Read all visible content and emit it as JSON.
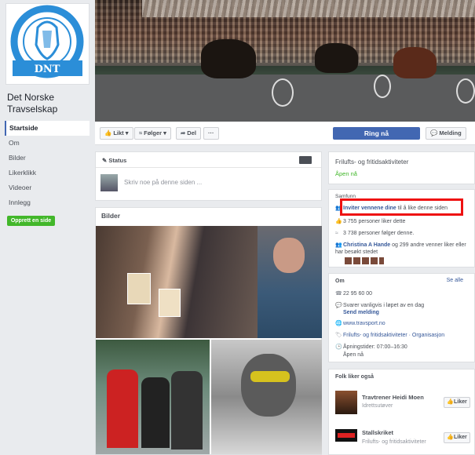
{
  "page": {
    "name": "Det Norske Travselskap",
    "logo_text": "DNT"
  },
  "left_nav": {
    "items": [
      "Startside",
      "Om",
      "Bilder",
      "Likerklikk",
      "Videoer",
      "Innlegg"
    ],
    "active": "Startside",
    "create_button": "Opprett en side"
  },
  "actions": {
    "liked": "Likt",
    "following": "Følger",
    "share": "Del",
    "more": "···",
    "call": "Ring nå",
    "message": "Melding"
  },
  "status": {
    "tab": "Status",
    "placeholder": "Skriv noe på denne siden ..."
  },
  "photos": {
    "title": "Bilder"
  },
  "category_card": {
    "category": "Frilufts- og fritidsaktiviteter",
    "open": "Åpen nå"
  },
  "community": {
    "header": "Samfunn",
    "invite_link": "Inviter vennene dine",
    "invite_rest": " til å like denne siden",
    "likes": "3 755 personer liker dette",
    "follows": "3 738 personer følger denne.",
    "friend_link": "Christina A Hande",
    "friend_rest": " og 299 andre venner liker eller har besøkt stedet"
  },
  "about": {
    "header": "Om",
    "see_all": "Se alle",
    "phone": "22 95 60 00",
    "response": "Svarer vanligvis i løpet av en dag",
    "send_message": "Send melding",
    "website": "www.travsport.no",
    "categories": "Frilufts- og fritidsaktiviteter · Organisasjon",
    "hours": "Åpningstider: 07:00–16:30",
    "hours_status": "Åpen nå"
  },
  "people_like": {
    "header": "Folk liker også",
    "pages": [
      {
        "name": "Travtrener Heidi Moen",
        "category": "Idrettsutøver",
        "button": "Liker"
      },
      {
        "name": "Stallskriket",
        "category": "Frilufts- og fritidsaktiviteter",
        "button": "Liker"
      }
    ]
  },
  "colors": {
    "accent": "#4267b2",
    "green": "#42b72a",
    "highlight": "#e11111",
    "background": "#e9ebee"
  }
}
